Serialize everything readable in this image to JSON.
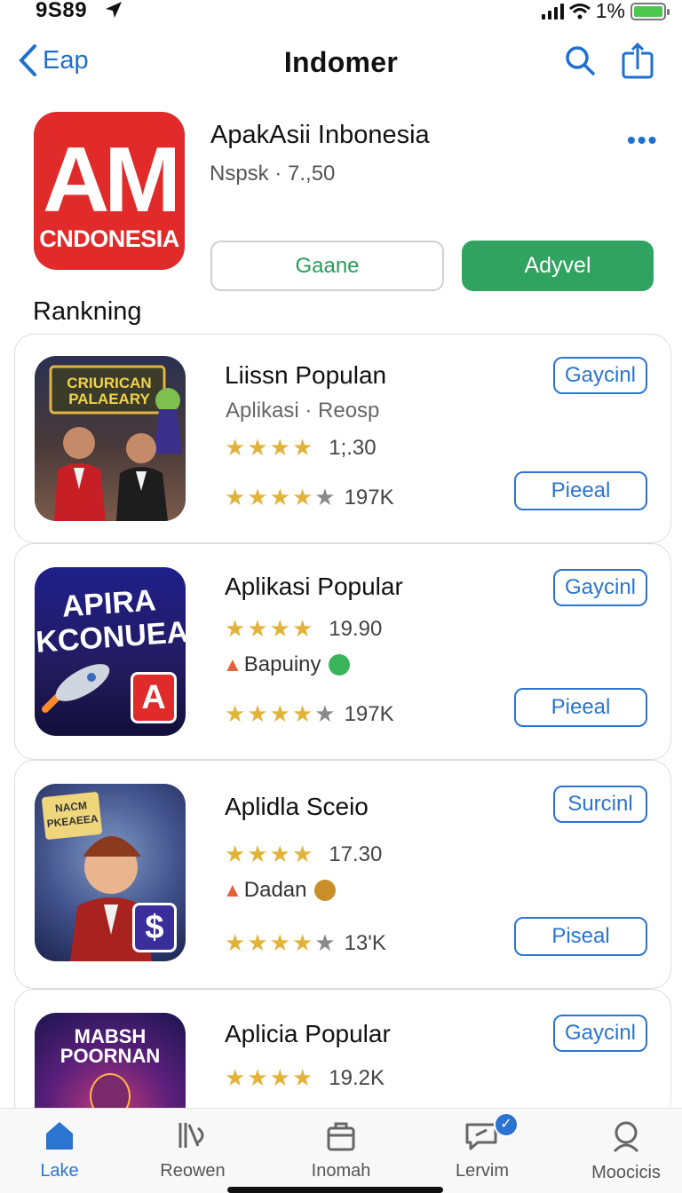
{
  "status": {
    "time": "9S89",
    "battery": "1%"
  },
  "nav": {
    "back_label": "Eap",
    "title": "Indomer"
  },
  "hero": {
    "icon_big": "AM",
    "icon_small": "CNDONESIA",
    "title": "ApakAsii Inbonesia",
    "subtitle": "Nspsk · 7.,50",
    "more": "•••",
    "secondary_button": "Gaane",
    "primary_button": "Adyvel"
  },
  "section": {
    "label": "Rankning"
  },
  "apps": [
    {
      "name": "Liissn Populan",
      "meta": "Aplikasi · Reosp",
      "rating": "1;.30",
      "reviews": "197K",
      "action": "Gaycinl",
      "secondary": "Pieeal",
      "icon_title": "CRIURICAN PALAEARY"
    },
    {
      "name": "Aplikasi Popular",
      "rating": "19.90",
      "tag": "Bapuiny",
      "reviews": "197K",
      "action": "Gaycinl",
      "secondary": "Pieeal",
      "icon_title_1": "APIRA",
      "icon_title_2": "KCONUEAI",
      "icon_badge": "A"
    },
    {
      "name": "Aplidla Sceio",
      "rating": "17.30",
      "tag": "Dadan",
      "reviews": "13'K",
      "action": "Surcinl",
      "secondary": "Piseal",
      "icon_sign": "NACM PKEAEEA",
      "icon_badge": "$"
    },
    {
      "name": "Aplicia Popular",
      "rating": "19.2K",
      "action": "Gaycinl",
      "icon_title_1": "MABSH",
      "icon_title_2": "POORNAN"
    }
  ],
  "tabs": [
    {
      "label": "Lake",
      "icon": "home-icon"
    },
    {
      "label": "Reowen",
      "icon": "books-icon"
    },
    {
      "label": "Inomah",
      "icon": "bag-icon"
    },
    {
      "label": "Lervim",
      "icon": "chat-icon",
      "badge": "✓"
    },
    {
      "label": "Moocicis",
      "icon": "search-icon"
    }
  ],
  "colors": {
    "accent": "#2b74d1",
    "green": "#2fa35f",
    "red": "#e12b2b",
    "star": "#e2b33a"
  }
}
